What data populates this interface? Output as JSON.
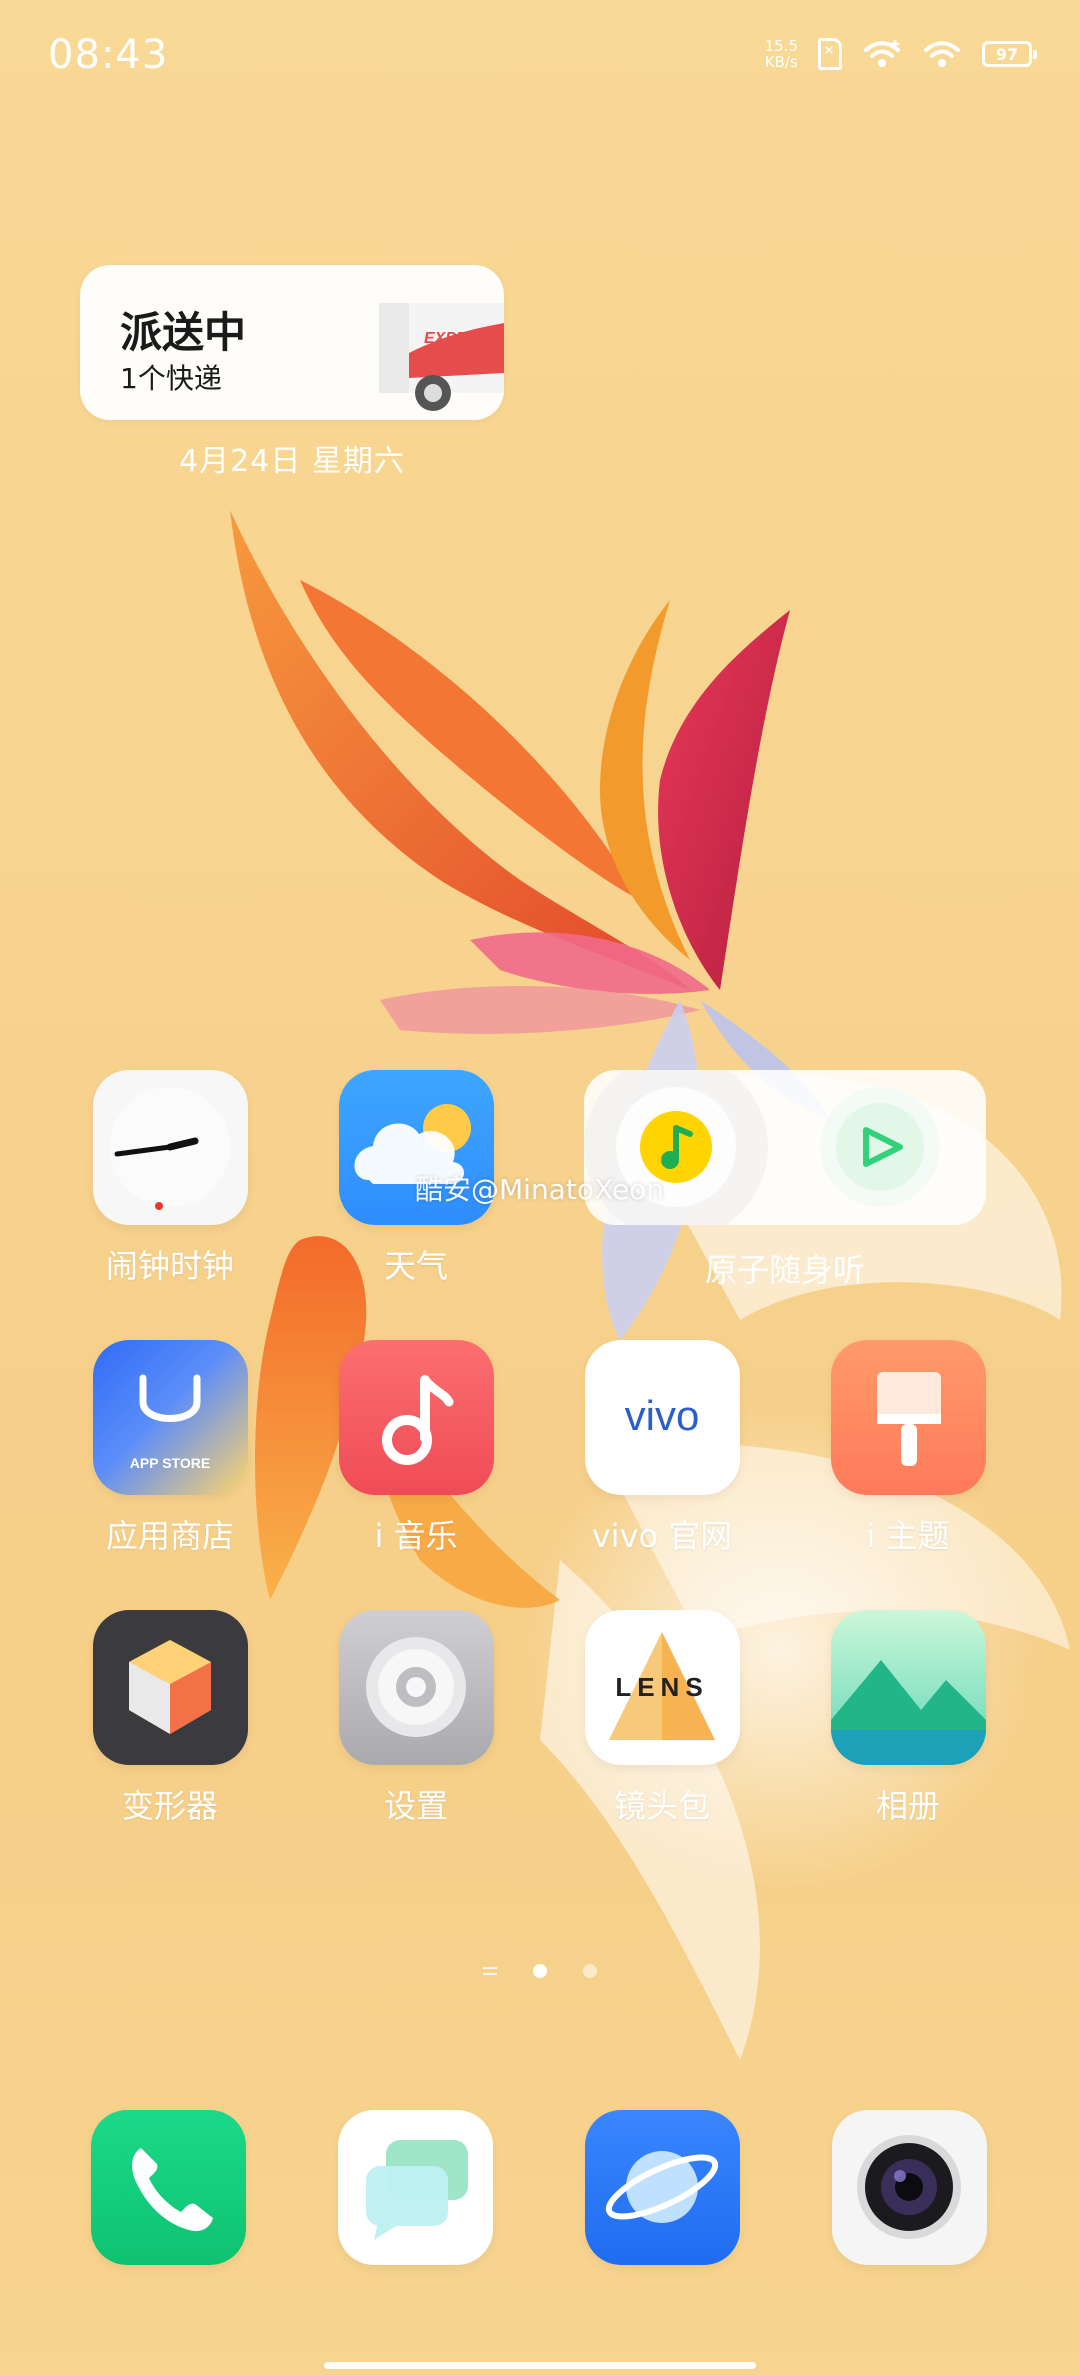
{
  "status_bar": {
    "time": "08:43",
    "net_speed_value": "15.5",
    "net_speed_unit": "KB/s",
    "battery": "97"
  },
  "express_widget": {
    "title": "派送中",
    "subtitle": "1个快递",
    "truck_text": "EXPRESS"
  },
  "date_label": "4月24日 星期六",
  "apps": {
    "clock": "闹钟时钟",
    "weather": "天气",
    "music_widget": "原子随身听",
    "app_store": "应用商店",
    "app_store_text": "APP STORE",
    "i_music": "i 音乐",
    "vivo_site": "vivo 官网",
    "vivo_logo": "vivo",
    "i_theme": "i 主题",
    "transformer": "变形器",
    "settings": "设置",
    "lens": "镜头包",
    "lens_text": "LENS",
    "gallery": "相册"
  },
  "watermark": "酷安@MinatoXeon",
  "page_indicator": {
    "pages": 2,
    "active": 1
  },
  "dock": [
    "phone-icon",
    "messages-icon",
    "browser-icon",
    "camera-icon"
  ],
  "colors": {
    "wallpaper": "#f7d38f",
    "phone_green": "#12d07a",
    "browser_blue": "#2a7bf4",
    "music_red": "#f55a5a",
    "theme_orange": "#ff8a5e"
  }
}
